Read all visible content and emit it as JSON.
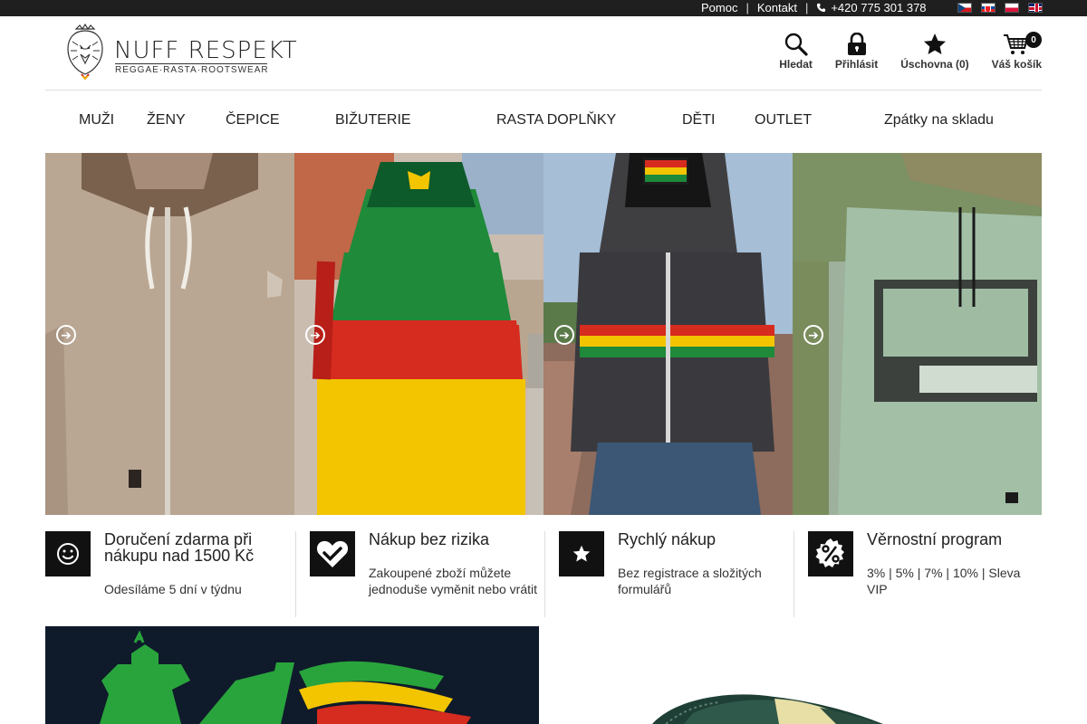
{
  "topbar": {
    "help": "Pomoc",
    "contact": "Kontakt",
    "phone": "+420 775 301 378",
    "languages": [
      "cz",
      "sk",
      "pl",
      "gb"
    ]
  },
  "logo": {
    "brand": "NUFF RESPEKT",
    "tagline": "REGGAE·RASTA·ROOTSWEAR"
  },
  "actions": {
    "search": "Hledat",
    "login": "Přihlásit",
    "wishlist": "Úschovna (0)",
    "cart": "Váš košík",
    "cart_count": "0"
  },
  "nav": [
    "MUŽI",
    "ŽENY",
    "ČEPICE",
    "BIŽUTERIE",
    "RASTA DOPLŇKY",
    "DĚTI",
    "OUTLET",
    "Zpátky na skladu"
  ],
  "features": [
    {
      "icon": "smiley-icon",
      "title": "Doručení zdarma při nákupu nad 1500 Kč",
      "desc": "Odesíláme 5 dní v týdnu"
    },
    {
      "icon": "heart-check-icon",
      "title": "Nákup bez rizika",
      "desc": "Zakoupené zboží můžete jednoduše vyměnit nebo vrátit"
    },
    {
      "icon": "star-icon",
      "title": "Rychlý nákup",
      "desc": "Bez registrace a složitých formulářů"
    },
    {
      "icon": "percent-icon",
      "title": "Věrnostní program",
      "desc": "3% | 5% | 7% | 10% | Sleva VIP"
    }
  ],
  "colors": {
    "topbar": "#1f1f1f",
    "icon_box": "#111111",
    "rasta_red": "#d62b1f",
    "rasta_yellow": "#f2c500",
    "rasta_green": "#1f8a3a"
  }
}
